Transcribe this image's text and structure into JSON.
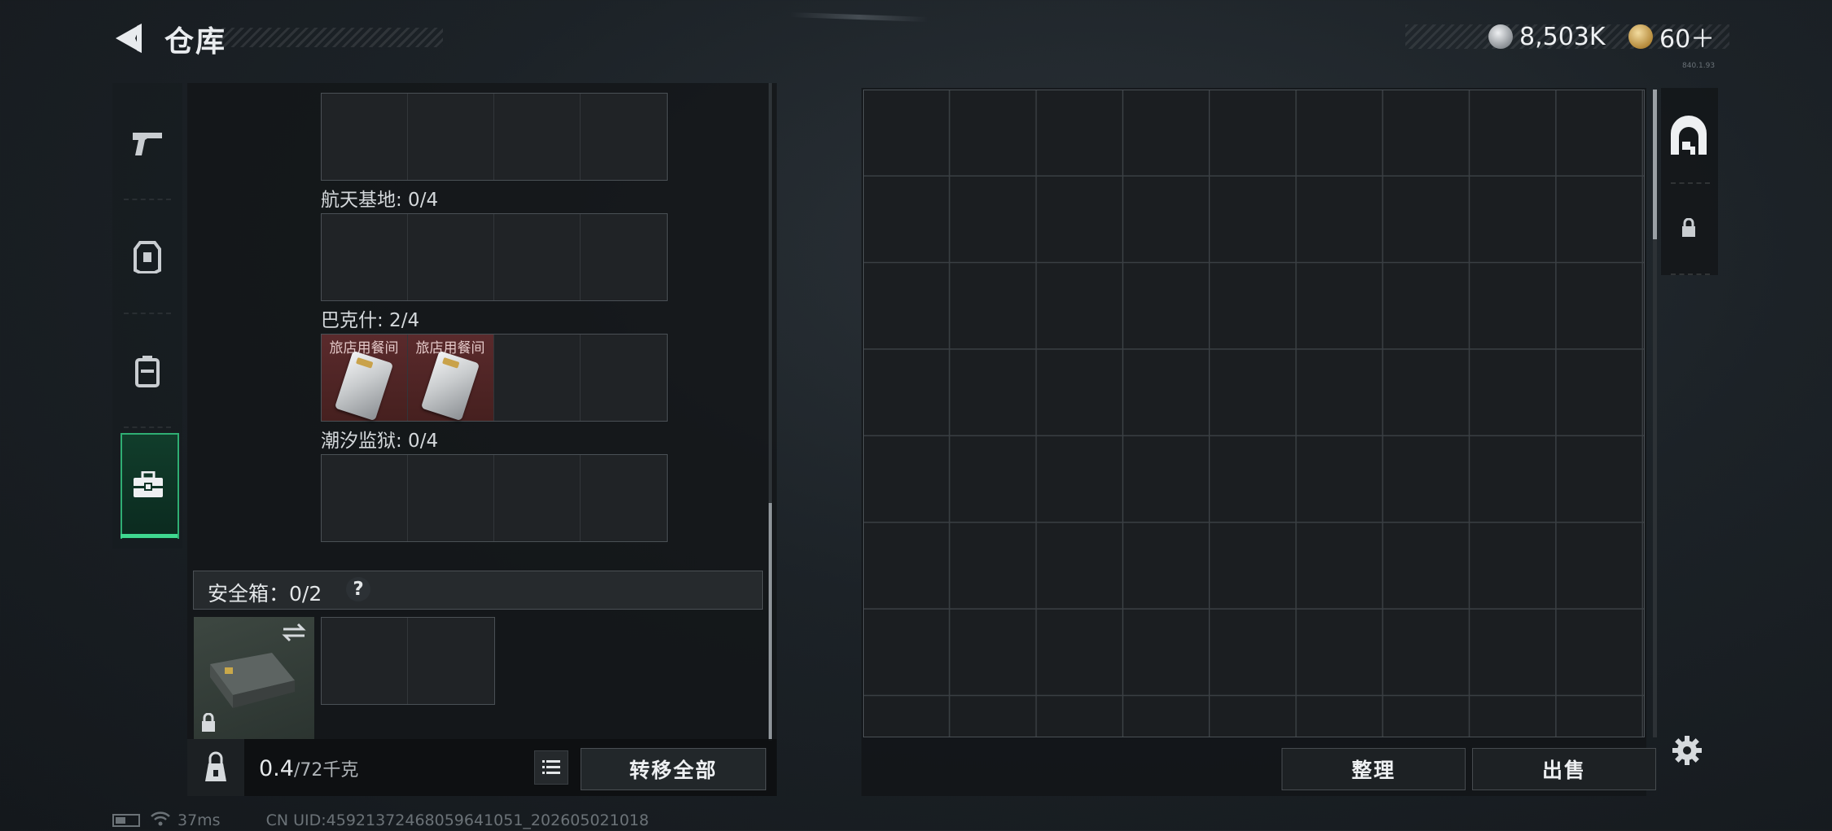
{
  "header": {
    "title": "仓库",
    "currency_silver": "8,503K",
    "currency_gold": "60＋",
    "version": "840.1.93"
  },
  "nav": {
    "items": [
      {
        "icon": "pistol-icon"
      },
      {
        "icon": "armor-vest-icon"
      },
      {
        "icon": "backpack-icon"
      },
      {
        "icon": "toolbox-icon",
        "active": true
      }
    ]
  },
  "left_panel": {
    "sections": [
      {
        "label": "航天基地: 0/4",
        "slots": 4,
        "items": []
      },
      {
        "label": "巴克什: 2/4",
        "slots": 4,
        "items": [
          "旅店用餐间",
          "旅店用餐间"
        ]
      },
      {
        "label": "潮汐监狱: 0/4",
        "slots": 4,
        "items": []
      }
    ],
    "safe_box": {
      "label": "安全箱：0/2",
      "help": "?"
    },
    "weight_value": "0.4",
    "weight_max": "/72千克",
    "transfer_all": "转移全部"
  },
  "right_panel": {
    "sort_button": "整理",
    "sell_button": "出售"
  },
  "status_bar": {
    "ping": "37ms",
    "uid": "CN UID:45921372468059641051_202605021018"
  },
  "colors": {
    "accent_green": "#3fd890",
    "item_rare_red": "#5a2a2c"
  }
}
